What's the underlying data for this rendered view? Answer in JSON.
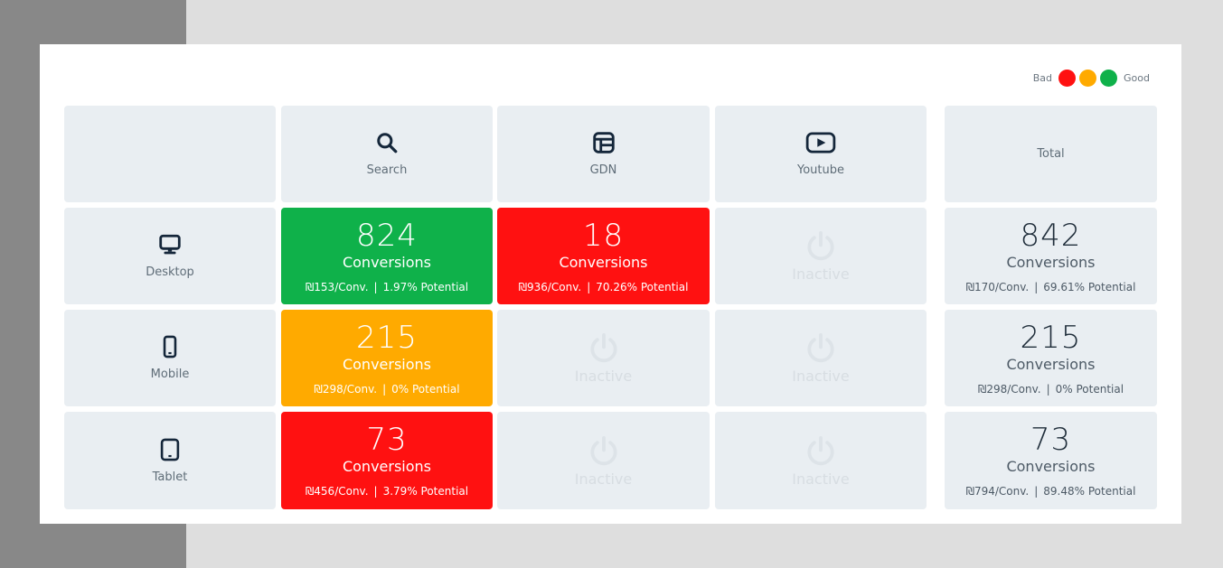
{
  "legend": {
    "bad_label": "Bad",
    "good_label": "Good",
    "colors": {
      "bad": "#ff1111",
      "mid": "#ffaa00",
      "good": "#0fb14a"
    }
  },
  "columns": [
    {
      "label": "Search",
      "icon": "search-icon"
    },
    {
      "label": "GDN",
      "icon": "layout-icon"
    },
    {
      "label": "Youtube",
      "icon": "youtube-play-icon"
    }
  ],
  "total_header": "Total",
  "rows": [
    {
      "label": "Desktop",
      "icon": "desktop-icon",
      "cells": [
        {
          "status": "good",
          "value": "824",
          "unit": "Conversions",
          "cpa": "₪153/Conv.",
          "potential": "1.97% Potential"
        },
        {
          "status": "bad",
          "value": "18",
          "unit": "Conversions",
          "cpa": "₪936/Conv.",
          "potential": "70.26% Potential"
        },
        {
          "status": "inactive",
          "label": "Inactive"
        }
      ],
      "total": {
        "value": "842",
        "unit": "Conversions",
        "cpa": "₪170/Conv.",
        "potential": "69.61% Potential"
      }
    },
    {
      "label": "Mobile",
      "icon": "mobile-icon",
      "cells": [
        {
          "status": "mid",
          "value": "215",
          "unit": "Conversions",
          "cpa": "₪298/Conv.",
          "potential": "0% Potential"
        },
        {
          "status": "inactive",
          "label": "Inactive"
        },
        {
          "status": "inactive",
          "label": "Inactive"
        }
      ],
      "total": {
        "value": "215",
        "unit": "Conversions",
        "cpa": "₪298/Conv.",
        "potential": "0% Potential"
      }
    },
    {
      "label": "Tablet",
      "icon": "tablet-icon",
      "cells": [
        {
          "status": "bad",
          "value": "73",
          "unit": "Conversions",
          "cpa": "₪456/Conv.",
          "potential": "3.79% Potential"
        },
        {
          "status": "inactive",
          "label": "Inactive"
        },
        {
          "status": "inactive",
          "label": "Inactive"
        }
      ],
      "total": {
        "value": "73",
        "unit": "Conversions",
        "cpa": "₪794/Conv.",
        "potential": "89.48% Potential"
      }
    }
  ],
  "separator": "|"
}
